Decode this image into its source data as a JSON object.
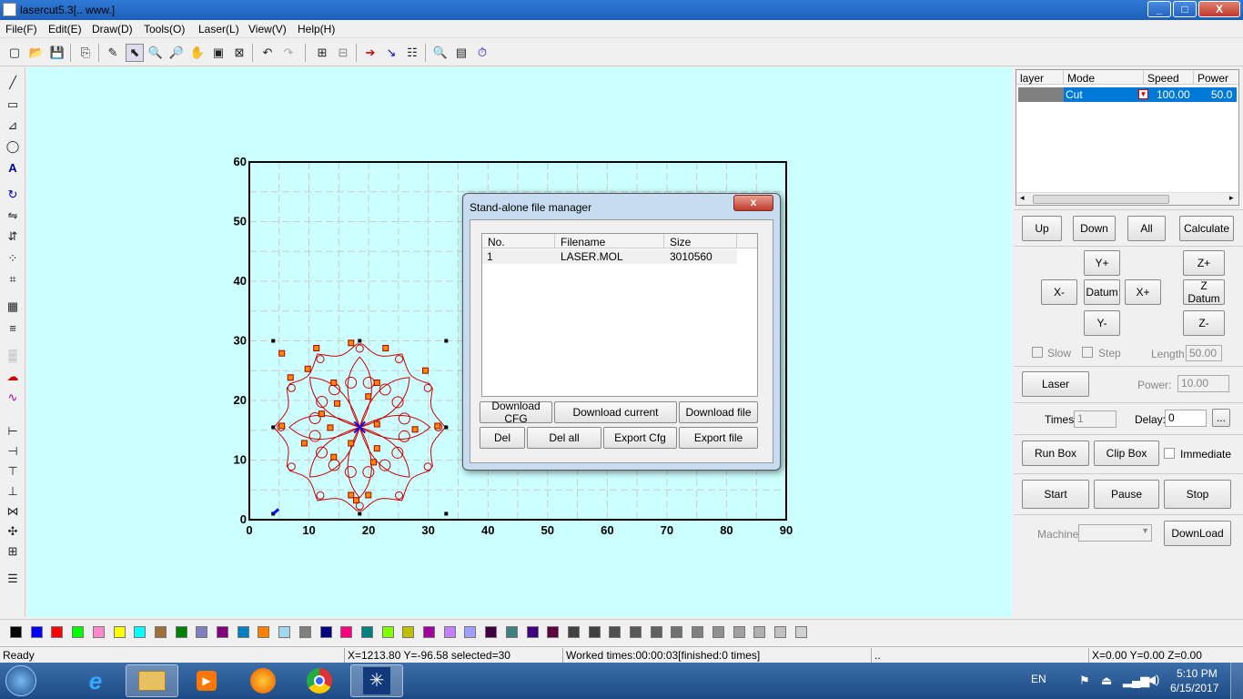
{
  "window": {
    "title": "lasercut5.3[.. www.]",
    "minimize": "_",
    "maximize": "□",
    "close": "X"
  },
  "menu": [
    "File(F)",
    "Edit(E)",
    "Draw(D)",
    "Tools(O)",
    "Laser(L)",
    "View(V)",
    "Help(H)"
  ],
  "toolbar_icons": [
    "new-file-icon",
    "open-folder-icon",
    "save-icon",
    "import-icon",
    "brush-icon",
    "select-icon",
    "zoom-in-icon",
    "zoom-out-icon",
    "pan-hand-icon",
    "zoom-page-icon",
    "zoom-fit-icon",
    "undo-icon",
    "redo-icon",
    "group-icon",
    "ungroup-icon",
    "cut-direction-icon",
    "start-point-icon",
    "array-icon",
    "preview-icon",
    "table-icon",
    "clock-icon"
  ],
  "left_tool_icons": [
    "line-icon",
    "rectangle-icon",
    "polyline-icon",
    "ellipse-icon",
    "text-icon",
    "rotate-icon",
    "mirror-h-icon",
    "mirror-v-icon",
    "node-edit-icon",
    "crop-icon",
    "grid-icon",
    "align-icon",
    "hatch-icon",
    "cloud-icon",
    "curve-icon",
    "align-left-icon",
    "align-center-icon",
    "align-top-icon",
    "align-bottom-icon",
    "center-h-icon",
    "center-v-icon",
    "center-both-icon",
    "layers-icon"
  ],
  "chart_data": {
    "type": "scatter",
    "x_ticks": [
      "0",
      "10",
      "20",
      "30",
      "40",
      "50",
      "60",
      "70",
      "80",
      "90"
    ],
    "y_ticks": [
      "0",
      "10",
      "20",
      "30",
      "40",
      "50",
      "60"
    ],
    "xlim": [
      0,
      90
    ],
    "ylim": [
      0,
      60
    ],
    "grid": true,
    "selection_box": {
      "x": [
        4,
        33
      ],
      "y": [
        1,
        30
      ]
    },
    "center_mark": [
      18.5,
      15.5
    ]
  },
  "layer_table": {
    "headers": [
      "layer",
      "Mode",
      "Speed",
      "Power"
    ],
    "rows": [
      {
        "layer": "",
        "mode": "Cut",
        "speed": "100.00",
        "power": "50.0"
      }
    ],
    "layer_color": "#808080"
  },
  "controls": {
    "up": "Up",
    "down": "Down",
    "all": "All",
    "calculate": "Calculate",
    "y_plus": "Y+",
    "z_plus": "Z+",
    "x_minus": "X-",
    "datum": "Datum",
    "x_plus": "X+",
    "z_datum": "Z Datum",
    "y_minus": "Y-",
    "z_minus": "Z-",
    "slow": "Slow",
    "step": "Step",
    "length_label": "Length:",
    "length_value": "50.00",
    "laser": "Laser",
    "power_label": "Power:",
    "power_value": "10.00",
    "times_label": "Times:",
    "times_value": "1",
    "delay_label": "Delay:",
    "delay_value": "0",
    "browse": "...",
    "run_box": "Run Box",
    "clip_box": "Clip Box",
    "immediate": "Immediate",
    "start": "Start",
    "pause": "Pause",
    "stop": "Stop",
    "machine_label": "Machine:",
    "machine_value": "",
    "download": "DownLoad"
  },
  "dialog": {
    "title": "Stand-alone file manager",
    "close": "x",
    "columns": [
      "No.",
      "Filename",
      "Size"
    ],
    "rows": [
      {
        "no": "1",
        "filename": "LASER.MOL",
        "size": "3010560"
      }
    ],
    "buttons_row1": [
      "Download CFG",
      "Download current",
      "Download file"
    ],
    "buttons_row2": [
      "Del",
      "Del all",
      "Export Cfg",
      "Export file"
    ]
  },
  "palette": [
    "#000000",
    "#0000ff",
    "#ff0000",
    "#00ff00",
    "#ff88cc",
    "#ffff00",
    "#00ffff",
    "#a0703c",
    "#008000",
    "#8080c0",
    "#800080",
    "#0080c0",
    "#ff8000",
    "#a0d8f0",
    "#808080",
    "#000080",
    "#ff0080",
    "#008080",
    "#80ff00",
    "#c0c000",
    "#a000a0",
    "#c080ff",
    "#a0a0ff",
    "#400040",
    "#408080",
    "#400080",
    "#600040",
    "#404040",
    "#404040",
    "#505050",
    "#585858",
    "#606060",
    "#707070",
    "#808080",
    "#909090",
    "#a0a0a0",
    "#b0b0b0",
    "#c0c0c0",
    "#d0d0d0"
  ],
  "status": {
    "ready": "Ready",
    "coords": "X=1213.80 Y=-96.58 selected=30",
    "worked": "Worked times:00:00:03[finished:0 times]",
    "dots": "..",
    "position": "X=0.00 Y=0.00 Z=0.00"
  },
  "taskbar": {
    "apps": [
      "windows-start-icon",
      "internet-explorer-icon",
      "file-explorer-icon",
      "media-player-icon",
      "firefox-icon",
      "chrome-icon",
      "lasercut-icon"
    ],
    "lang": "EN",
    "time": "5:10 PM",
    "date": "6/15/2017"
  }
}
